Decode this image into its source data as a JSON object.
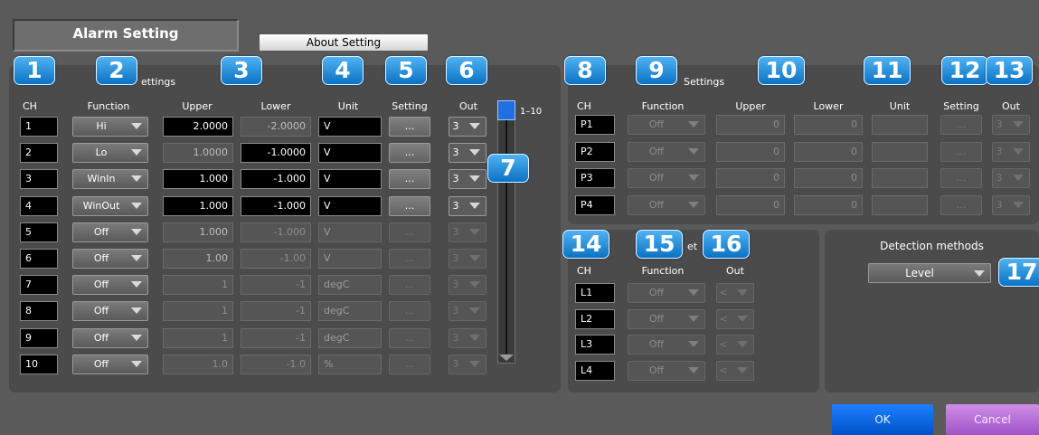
{
  "window": {
    "title": "Alarm Setting",
    "about_button": "About Setting"
  },
  "alarm_panel": {
    "header_partial": "ettings",
    "columns": {
      "ch": "CH",
      "function": "Function",
      "upper": "Upper",
      "lower": "Lower",
      "unit": "Unit",
      "setting": "Setting",
      "out": "Out"
    },
    "scroll_label": "1–10",
    "rows": [
      {
        "ch": "1",
        "function": "Hi",
        "upper": "2.0000",
        "lower": "-2.0000",
        "unit": "V",
        "setting": "...",
        "out": "3"
      },
      {
        "ch": "2",
        "function": "Lo",
        "upper": "1.0000",
        "lower": "-1.0000",
        "unit": "V",
        "setting": "...",
        "out": "3"
      },
      {
        "ch": "3",
        "function": "WinIn",
        "upper": "1.000",
        "lower": "-1.000",
        "unit": "V",
        "setting": "...",
        "out": "3"
      },
      {
        "ch": "4",
        "function": "WinOut",
        "upper": "1.000",
        "lower": "-1.000",
        "unit": "V",
        "setting": "...",
        "out": "3"
      },
      {
        "ch": "5",
        "function": "Off",
        "upper": "1.000",
        "lower": "-1.000",
        "unit": "V",
        "setting": "...",
        "out": "3"
      },
      {
        "ch": "6",
        "function": "Off",
        "upper": "1.00",
        "lower": "-1.00",
        "unit": "V",
        "setting": "...",
        "out": "3"
      },
      {
        "ch": "7",
        "function": "Off",
        "upper": "1",
        "lower": "-1",
        "unit": "degC",
        "setting": "...",
        "out": "3"
      },
      {
        "ch": "8",
        "function": "Off",
        "upper": "1",
        "lower": "-1",
        "unit": "degC",
        "setting": "...",
        "out": "3"
      },
      {
        "ch": "9",
        "function": "Off",
        "upper": "1",
        "lower": "-1",
        "unit": "degC",
        "setting": "...",
        "out": "3"
      },
      {
        "ch": "10",
        "function": "Off",
        "upper": "1.0",
        "lower": "-1.0",
        "unit": "%",
        "setting": "...",
        "out": "3"
      }
    ]
  },
  "pulse_panel": {
    "header_partial": "Settings",
    "columns": {
      "ch": "CH",
      "function": "Function",
      "upper": "Upper",
      "lower": "Lower",
      "unit": "Unit",
      "setting": "Setting",
      "out": "Out"
    },
    "rows": [
      {
        "ch": "P1",
        "function": "Off",
        "upper": "0",
        "lower": "0",
        "unit": "",
        "setting": "...",
        "out": "3"
      },
      {
        "ch": "P2",
        "function": "Off",
        "upper": "0",
        "lower": "0",
        "unit": "",
        "setting": "...",
        "out": "3"
      },
      {
        "ch": "P3",
        "function": "Off",
        "upper": "0",
        "lower": "0",
        "unit": "",
        "setting": "...",
        "out": "3"
      },
      {
        "ch": "P4",
        "function": "Off",
        "upper": "0",
        "lower": "0",
        "unit": "",
        "setting": "...",
        "out": "3"
      }
    ]
  },
  "logic_panel": {
    "header_partial": "et",
    "columns": {
      "ch": "CH",
      "function": "Function",
      "out": "Out"
    },
    "rows": [
      {
        "ch": "L1",
        "function": "Off",
        "out": "<"
      },
      {
        "ch": "L2",
        "function": "Off",
        "out": "<"
      },
      {
        "ch": "L3",
        "function": "Off",
        "out": "<"
      },
      {
        "ch": "L4",
        "function": "Off",
        "out": "<"
      }
    ]
  },
  "detection": {
    "label": "Detection methods",
    "value": "Level"
  },
  "footer": {
    "ok": "OK",
    "cancel": "Cancel"
  },
  "badges": [
    "1",
    "2",
    "3",
    "4",
    "5",
    "6",
    "7",
    "8",
    "9",
    "10",
    "11",
    "12",
    "13",
    "14",
    "15",
    "16",
    "17"
  ],
  "colors": {
    "badge": "#1a86d6",
    "ok": "#0a66e0",
    "cancel": "#b86ad8",
    "scroll_thumb": "#1e6fe0"
  }
}
